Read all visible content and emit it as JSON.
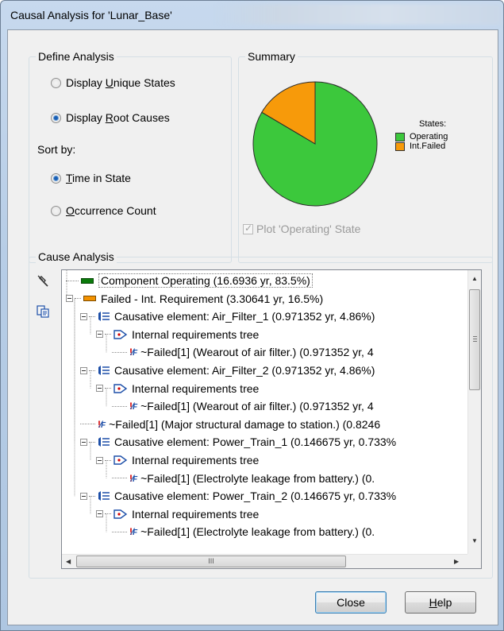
{
  "window": {
    "title": "Causal Analysis for 'Lunar_Base'"
  },
  "define_analysis": {
    "legend": "Define Analysis",
    "display_unique_states": "Display Unique States",
    "display_root_causes": "Display Root Causes",
    "selected_display": "Display Root Causes",
    "sort_by_label": "Sort by:",
    "time_in_state": "Time in State",
    "occurrence_count": "Occurrence Count",
    "selected_sort": "Time in State"
  },
  "summary": {
    "legend": "Summary",
    "chart_legend_title": "States:",
    "plot_operating_label": "Plot 'Operating' State",
    "plot_operating_checked": true,
    "plot_operating_enabled": false
  },
  "chart_data": {
    "type": "pie",
    "legend_title": "States:",
    "legend_position": "right",
    "slices": [
      {
        "label": "Operating",
        "value": 83.5,
        "color": "#3cc83c"
      },
      {
        "label": "Int.Failed",
        "value": 16.5,
        "color": "#f79a0a"
      }
    ]
  },
  "cause_analysis": {
    "legend": "Cause Analysis",
    "tools": [
      "pin-icon",
      "copy-icon"
    ],
    "rows": [
      {
        "text": "Component Operating (16.6936 yr, 83.5%)",
        "icon": "green-bar",
        "level": 0,
        "expander": false,
        "selected": true
      },
      {
        "text": "Failed - Int. Requirement (3.30641 yr, 16.5%)",
        "icon": "orange-bar",
        "level": 0,
        "expander": true
      },
      {
        "text": "Causative element: Air_Filter_1 (0.971352 yr, 4.86%)",
        "icon": "causative-element-icon",
        "level": 1,
        "expander": true
      },
      {
        "text": "Internal requirements tree",
        "icon": "requirements-tree-icon",
        "level": 2,
        "expander": true
      },
      {
        "text": "~Failed[1]  (Wearout of air filter.) (0.971352 yr, 4",
        "icon": "failure-icon",
        "level": 3,
        "expander": false
      },
      {
        "text": "Causative element: Air_Filter_2 (0.971352 yr, 4.86%)",
        "icon": "causative-element-icon",
        "level": 1,
        "expander": true
      },
      {
        "text": "Internal requirements tree",
        "icon": "requirements-tree-icon",
        "level": 2,
        "expander": true
      },
      {
        "text": "~Failed[1]  (Wearout of air filter.) (0.971352 yr, 4",
        "icon": "failure-icon",
        "level": 3,
        "expander": false
      },
      {
        "text": "~Failed[1]  (Major structural damage to station.) (0.8246",
        "icon": "failure-icon",
        "level": 1,
        "expander": false
      },
      {
        "text": "Causative element: Power_Train_1 (0.146675 yr, 0.733%",
        "icon": "causative-element-icon",
        "level": 1,
        "expander": true
      },
      {
        "text": "Internal requirements tree",
        "icon": "requirements-tree-icon",
        "level": 2,
        "expander": true
      },
      {
        "text": "~Failed[1]  (Electrolyte leakage from battery.) (0.",
        "icon": "failure-icon",
        "level": 3,
        "expander": false
      },
      {
        "text": "Causative element: Power_Train_2 (0.146675 yr, 0.733%",
        "icon": "causative-element-icon",
        "level": 1,
        "expander": true
      },
      {
        "text": "Internal requirements tree",
        "icon": "requirements-tree-icon",
        "level": 2,
        "expander": true
      },
      {
        "text": "~Failed[1]  (Electrolyte leakage from battery.) (0.",
        "icon": "failure-icon",
        "level": 3,
        "expander": false
      }
    ],
    "hscroll_grip": "III"
  },
  "buttons": {
    "close": "Close",
    "help": "Help"
  }
}
